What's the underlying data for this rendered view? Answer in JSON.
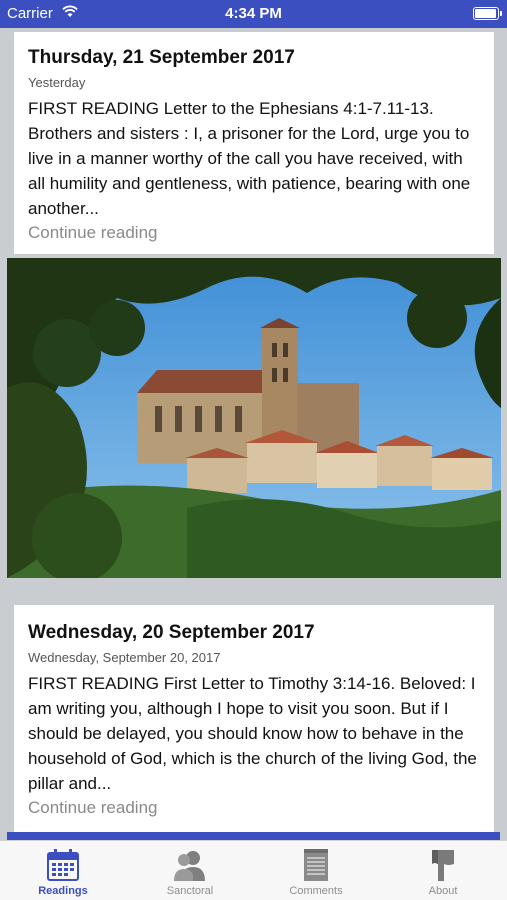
{
  "status_bar": {
    "carrier": "Carrier",
    "time": "4:34 PM",
    "battery_level": 0.95
  },
  "feed": {
    "items": [
      {
        "title": "Thursday, 21 September 2017",
        "date_label": "Yesterday",
        "excerpt": "FIRST READING Letter to the Ephesians 4:1-7.11-13. Brothers and sisters : I, a prisoner for the Lord, urge you to live in a manner worthy of the call you have received, with all humility and gentleness, with patience, bearing with one another...",
        "continue_label": "Continue reading",
        "image_icon": "church-landscape-image"
      },
      {
        "title": "Wednesday, 20 September 2017",
        "date_label": "Wednesday, September 20, 2017",
        "excerpt": "FIRST READING First Letter to Timothy 3:14-16. Beloved: I am writing you, although I hope to visit you soon. But if I should be delayed, you should know how to behave in the household of God, which is the church of the living God, the pillar and...",
        "continue_label": "Continue reading"
      }
    ]
  },
  "tab_bar": {
    "active_color": "#3b4fc1",
    "inactive_color": "#8e8e93",
    "tabs": [
      {
        "label": "Readings",
        "icon": "calendar-icon",
        "active": true
      },
      {
        "label": "Sanctoral",
        "icon": "people-icon",
        "active": false
      },
      {
        "label": "Comments",
        "icon": "notepad-icon",
        "active": false
      },
      {
        "label": "About",
        "icon": "flag-icon",
        "active": false
      }
    ]
  }
}
